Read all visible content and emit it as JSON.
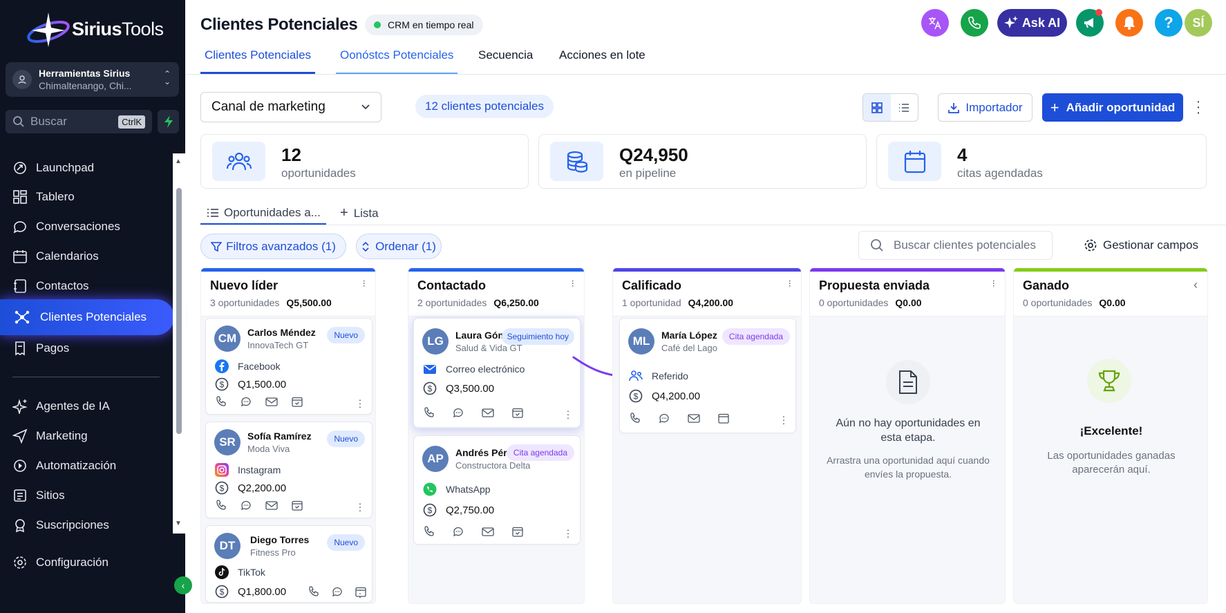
{
  "brand": {
    "name_bold": "Sirius",
    "name_light": "Tools"
  },
  "account": {
    "name": "Herramientas Sirius",
    "location": "Chimaltenango, Chi..."
  },
  "search": {
    "placeholder": "Buscar",
    "shortcut": "CtrlK"
  },
  "sidebar": {
    "items": [
      {
        "label": "Launchpad",
        "icon": "rocket-icon"
      },
      {
        "label": "Tablero",
        "icon": "dashboard-grid-icon"
      },
      {
        "label": "Conversaciones",
        "icon": "chat-bubble-icon"
      },
      {
        "label": "Calendarios",
        "icon": "calendar-icon"
      },
      {
        "label": "Contactos",
        "icon": "contacts-book-icon"
      },
      {
        "label": "Clientes Potenciales",
        "icon": "network-nodes-icon",
        "active": true
      },
      {
        "label": "Pagos",
        "icon": "receipt-icon"
      },
      {
        "label": "Agentes de IA",
        "icon": "sparkle-icon"
      },
      {
        "label": "Marketing",
        "icon": "send-icon"
      },
      {
        "label": "Automatización",
        "icon": "automation-icon"
      },
      {
        "label": "Sitios",
        "icon": "sites-icon"
      },
      {
        "label": "Suscripciones",
        "icon": "badge-icon"
      },
      {
        "label": "Configuración",
        "icon": "gear-icon"
      }
    ]
  },
  "header": {
    "title": "Clientes Potenciales",
    "live_label": "CRM en tiempo real",
    "ask_ai": "Ask AI",
    "avatar": "SÍ"
  },
  "tabs": [
    "Clientes Potenciales",
    "Oonóstcs Potenciales",
    "Secuencia",
    "Acciones en lote"
  ],
  "toolbar": {
    "pipeline": "Canal de marketing",
    "count": "12 clientes potenciales",
    "importer": "Importador",
    "add": "Añadir oportunidad"
  },
  "stats": [
    {
      "value": "12",
      "label": "oportunidades",
      "icon": "users-icon"
    },
    {
      "value": "Q24,950",
      "label": "en pipeline",
      "icon": "coins-icon"
    },
    {
      "value": "4",
      "label": "citas agendadas",
      "icon": "calendar-icon"
    }
  ],
  "subtabs": {
    "active": "Oportunidades a...",
    "add": "Lista"
  },
  "filters": {
    "advanced": "Filtros avanzados (1)",
    "sort": "Ordenar (1)",
    "search_placeholder": "Buscar clientes potenciales",
    "manage": "Gestionar campos"
  },
  "columns": [
    {
      "title": "Nuevo líder",
      "count": "3 oportunidades",
      "total": "Q5,500.00",
      "color": "#2563eb"
    },
    {
      "title": "Contactado",
      "count": "2 oportunidades",
      "total": "Q6,250.00",
      "color": "#2563eb"
    },
    {
      "title": "Calificado",
      "count": "1 oportunidad",
      "total": "Q4,200.00",
      "color": "#4f46e5"
    },
    {
      "title": "Propuesta enviada",
      "count": "0 oportunidades",
      "total": "Q0.00",
      "color": "#7c3aed"
    },
    {
      "title": "Ganado",
      "count": "0 oportunidades",
      "total": "Q0.00",
      "color": "#84cc16"
    }
  ],
  "cards": {
    "c1": {
      "initials": "CM",
      "name": "Carlos Méndez",
      "company": "InnovaTech GT",
      "badge": "Nuevo",
      "source": "Facebook",
      "amount": "Q1,500.00"
    },
    "c2": {
      "initials": "SR",
      "name": "Sofía Ramírez",
      "company": "Moda Viva",
      "badge": "Nuevo",
      "source": "Instagram",
      "amount": "Q2,200.00"
    },
    "c3": {
      "initials": "DT",
      "name": "Diego Torres",
      "company": "Fitness Pro",
      "badge": "Nuevo",
      "source": "TikTok",
      "amount": "Q1,800.00"
    },
    "c4": {
      "initials": "LG",
      "name": "Laura Gómez",
      "company": "Salud & Vida GT",
      "badge": "Seguimiento hoy",
      "source": "Correo electrónico",
      "amount": "Q3,500.00"
    },
    "c5": {
      "initials": "AP",
      "name": "Andrés Pérez",
      "company": "Constructora Delta",
      "badge": "Cita agendada",
      "source": "WhatsApp",
      "amount": "Q2,750.00"
    },
    "c6": {
      "initials": "ML",
      "name": "María López",
      "company": "Café del Lago",
      "badge": "Cita agendada",
      "source": "Referido",
      "amount": "Q4,200.00"
    }
  },
  "empty": {
    "proposal_title": "Aún no hay oportunidades en esta etapa.",
    "proposal_sub": "Arrastra una oportunidad aquí cuando envíes la propuesta.",
    "won_title": "¡Excelente!",
    "won_sub": "Las oportunidades ganadas aparecerán aquí."
  }
}
